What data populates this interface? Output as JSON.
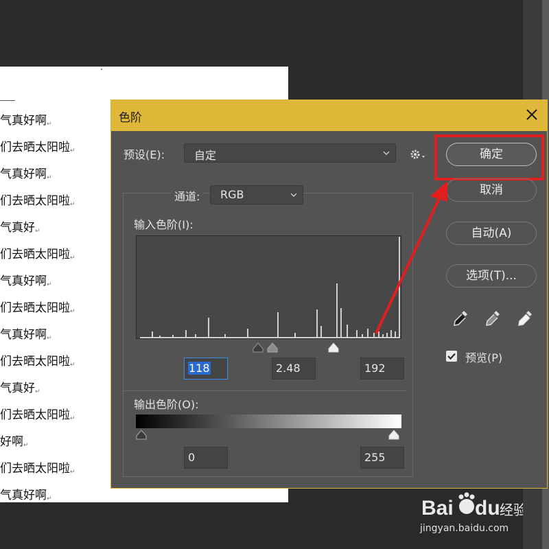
{
  "document": {
    "lines": [
      "气真好啊",
      "们去晒太阳啦",
      "气真好啊",
      "们去晒太阳啦",
      "气真好",
      "们去晒太阳啦",
      "气真好啊",
      "们去晒太阳啦",
      "气真好啊",
      "们去晒太阳啦",
      "气真好",
      "们去晒太阳啦",
      "好啊",
      "们去晒太阳啦",
      "气真好啊"
    ],
    "para_mark": "↵"
  },
  "dialog": {
    "title": "色阶",
    "preset_label": "预设(E):",
    "preset_value": "自定",
    "channel_label": "通道:",
    "channel_value": "RGB",
    "input_levels_label": "输入色阶(I):",
    "input_black": "118",
    "input_gamma": "2.48",
    "input_white": "192",
    "output_levels_label": "输出色阶(O):",
    "output_black": "0",
    "output_white": "255",
    "buttons": {
      "ok": "确定",
      "cancel": "取消",
      "auto": "自动(A)",
      "options": "选项(T)..."
    },
    "preview_label": "预览(P)",
    "preview_checked": true
  },
  "levels": {
    "input_black": 118,
    "input_gamma": 2.48,
    "input_white": 192,
    "output_black": 0,
    "output_white": 255
  },
  "icons": [
    "close-icon",
    "gear-icon",
    "chevron-down-icon",
    "eyedropper-black-icon",
    "eyedropper-gray-icon",
    "eyedropper-white-icon",
    "checkmark-icon"
  ],
  "colors": {
    "title_bar": "#dfb83a",
    "dialog_bg": "#535353",
    "highlight_box": "#e02020",
    "selection": "#2b6bd0"
  },
  "watermark": {
    "brand": "Bai du 经验",
    "url": "jingyan.baidu.com"
  }
}
